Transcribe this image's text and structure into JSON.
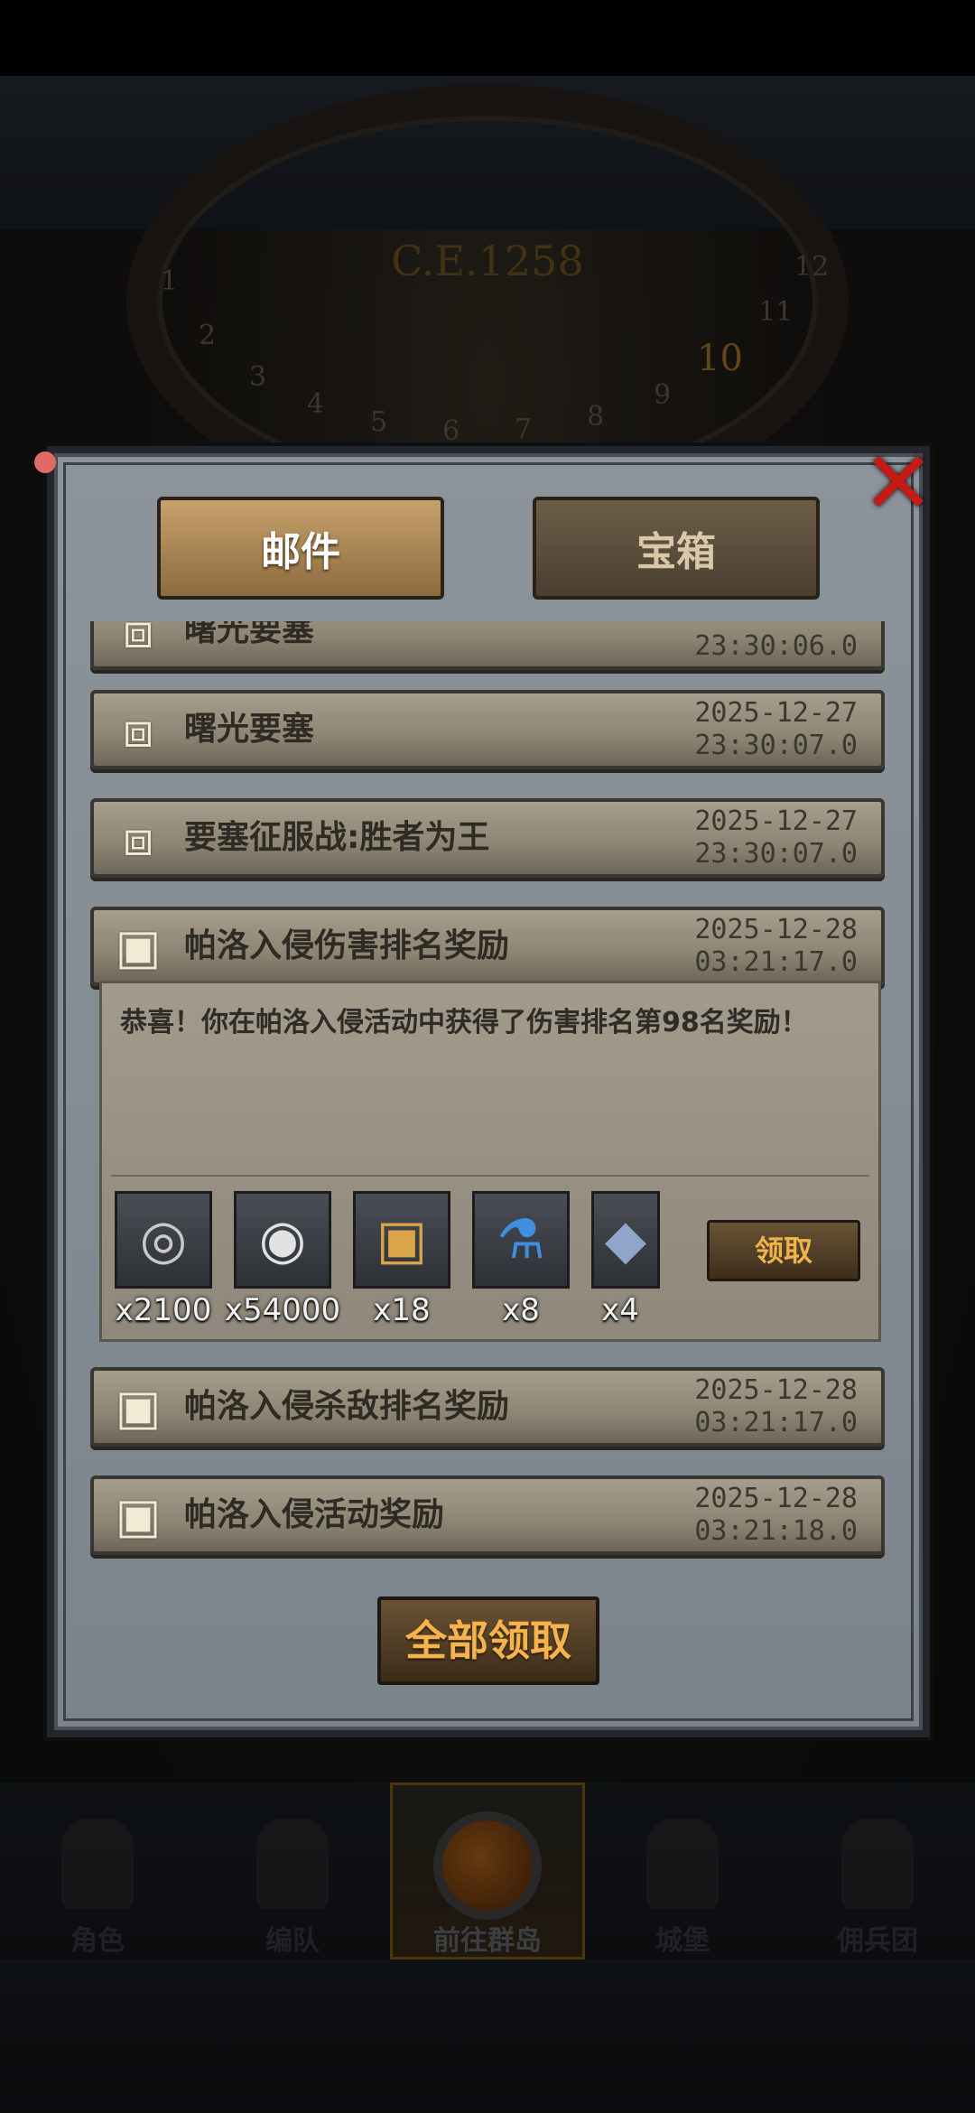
{
  "background": {
    "year_label": "C.E.1258",
    "dial_numbers": [
      "1",
      "2",
      "3",
      "4",
      "5",
      "6",
      "7",
      "8",
      "9",
      "10",
      "11",
      "12"
    ],
    "nav": [
      {
        "label": "角色"
      },
      {
        "label": "编队"
      },
      {
        "label": "前往群岛",
        "active": true
      },
      {
        "label": "城堡"
      },
      {
        "label": "佣兵团"
      }
    ]
  },
  "dialog": {
    "tabs": {
      "mail": "邮件",
      "chest": "宝箱"
    },
    "close_icon": "✕",
    "mails": [
      {
        "title": "曙光要塞",
        "date": "",
        "time": "23:30:06.0",
        "icon": "chest-icon"
      },
      {
        "title": "曙光要塞",
        "date": "2025-12-27",
        "time": "23:30:07.0",
        "icon": "chest-icon"
      },
      {
        "title": "要塞征服战:胜者为王",
        "date": "2025-12-27",
        "time": "23:30:07.0",
        "icon": "chest-icon"
      },
      {
        "title": "帕洛入侵伤害排名奖励",
        "date": "2025-12-28",
        "time": "03:21:17.0",
        "icon": "box-icon"
      },
      {
        "title": "帕洛入侵杀敌排名奖励",
        "date": "2025-12-28",
        "time": "03:21:17.0",
        "icon": "box-icon"
      },
      {
        "title": "帕洛入侵活动奖励",
        "date": "2025-12-28",
        "time": "03:21:18.0",
        "icon": "box-icon"
      }
    ],
    "open_mail": {
      "body": "恭喜！你在帕洛入侵活动中获得了伤害排名第98名奖励！",
      "rewards": [
        {
          "icon": "silver-coin-icon",
          "glyph": "◎",
          "count": "x2100"
        },
        {
          "icon": "coin-icon",
          "glyph": "◉",
          "count": "x54000"
        },
        {
          "icon": "treasure-chest-icon",
          "glyph": "▣",
          "count": "x18"
        },
        {
          "icon": "potion-icon",
          "glyph": "⚗",
          "count": "x8"
        },
        {
          "icon": "crystal-icon",
          "glyph": "◆",
          "count": "x4"
        }
      ],
      "claim_label": "领取"
    },
    "claim_all_label": "全部领取"
  }
}
